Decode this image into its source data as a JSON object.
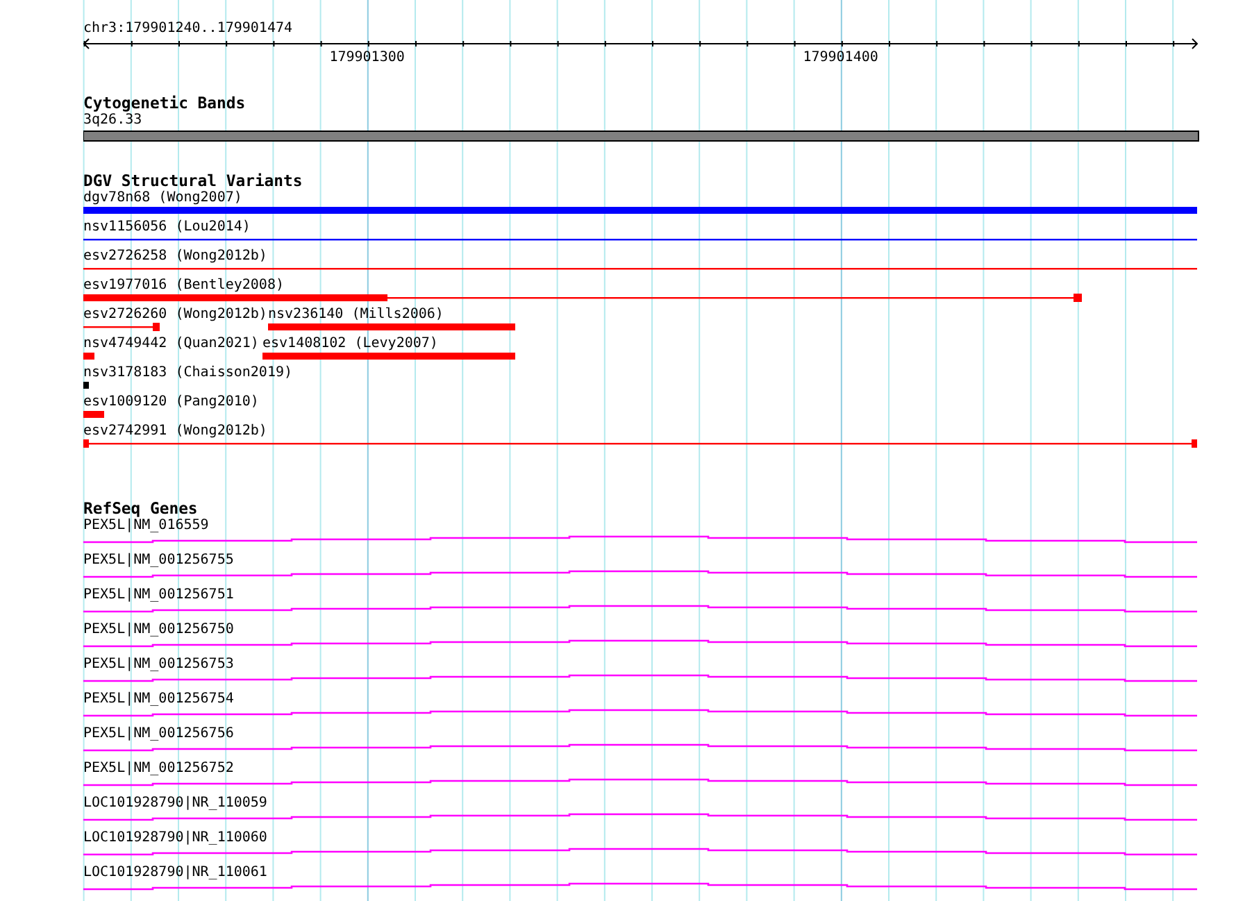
{
  "ruler": {
    "range": "chr3:179901240..179901474",
    "ticks": [
      "179901300",
      "179901400"
    ]
  },
  "cytogenetic_bands": {
    "title": "Cytogenetic Bands",
    "features": [
      {
        "label": "3q26.33"
      }
    ]
  },
  "dgv_structural_variants": {
    "title": "DGV Structural Variants",
    "rows": [
      [
        {
          "label": "dgv78n68 (Wong2007)",
          "color": "#0000ff"
        }
      ],
      [
        {
          "label": "nsv1156056 (Lou2014)",
          "color": "#0000ff"
        }
      ],
      [
        {
          "label": "esv2726258 (Wong2012b)",
          "color": "#ff0000"
        }
      ],
      [
        {
          "label": "esv1977016 (Bentley2008)",
          "color": "#ff0000"
        }
      ],
      [
        {
          "label": "esv2726260 (Wong2012b)",
          "color": "#ff0000"
        },
        {
          "label": "nsv236140 (Mills2006)",
          "color": "#ff0000"
        }
      ],
      [
        {
          "label": "nsv4749442 (Quan2021)",
          "color": "#ff0000"
        },
        {
          "label": "esv1408102 (Levy2007)",
          "color": "#ff0000"
        }
      ],
      [
        {
          "label": "nsv3178183 (Chaisson2019)",
          "color": "#000000"
        }
      ],
      [
        {
          "label": "esv1009120 (Pang2010)",
          "color": "#ff0000"
        }
      ],
      [
        {
          "label": "esv2742991 (Wong2012b)",
          "color": "#ff0000"
        }
      ]
    ]
  },
  "refseq_genes": {
    "title": "RefSeq Genes",
    "features": [
      {
        "label": "PEX5L|NM_016559"
      },
      {
        "label": "PEX5L|NM_001256755"
      },
      {
        "label": "PEX5L|NM_001256751"
      },
      {
        "label": "PEX5L|NM_001256750"
      },
      {
        "label": "PEX5L|NM_001256753"
      },
      {
        "label": "PEX5L|NM_001256754"
      },
      {
        "label": "PEX5L|NM_001256756"
      },
      {
        "label": "PEX5L|NM_001256752"
      },
      {
        "label": "LOC101928790|NR_110059"
      },
      {
        "label": "LOC101928790|NR_110060"
      },
      {
        "label": "LOC101928790|NR_110061"
      }
    ]
  }
}
